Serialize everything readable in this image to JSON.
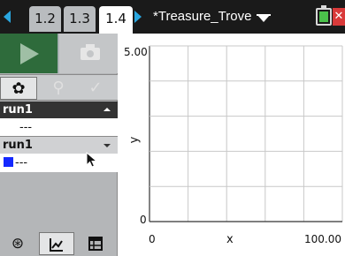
{
  "tabs": [
    {
      "label": "1.2"
    },
    {
      "label": "1.3"
    },
    {
      "label": "1.4"
    }
  ],
  "document": {
    "title": "*Treasure_Trove"
  },
  "close_label": "✕",
  "runs": [
    {
      "name": "run1",
      "value": "---"
    },
    {
      "name": "run1",
      "value": "---"
    }
  ],
  "graph": {
    "y_max_label": "5.00",
    "y_min_label": "0",
    "x_min_label": "0",
    "x_max_label": "100.00",
    "x_axis_label": "x",
    "y_axis_label": "y",
    "grid": true
  },
  "colors": {
    "accent": "#2aa7e0",
    "run_color": "#1428ff",
    "play": "#2e6b3b"
  },
  "icons": {
    "play": "play-icon",
    "camera": "camera-icon",
    "settings": "gear-icon",
    "marker": "pin-icon",
    "check": "checkmark-icon",
    "meter": "meter-icon",
    "graph": "graph-icon",
    "table": "table-icon"
  }
}
